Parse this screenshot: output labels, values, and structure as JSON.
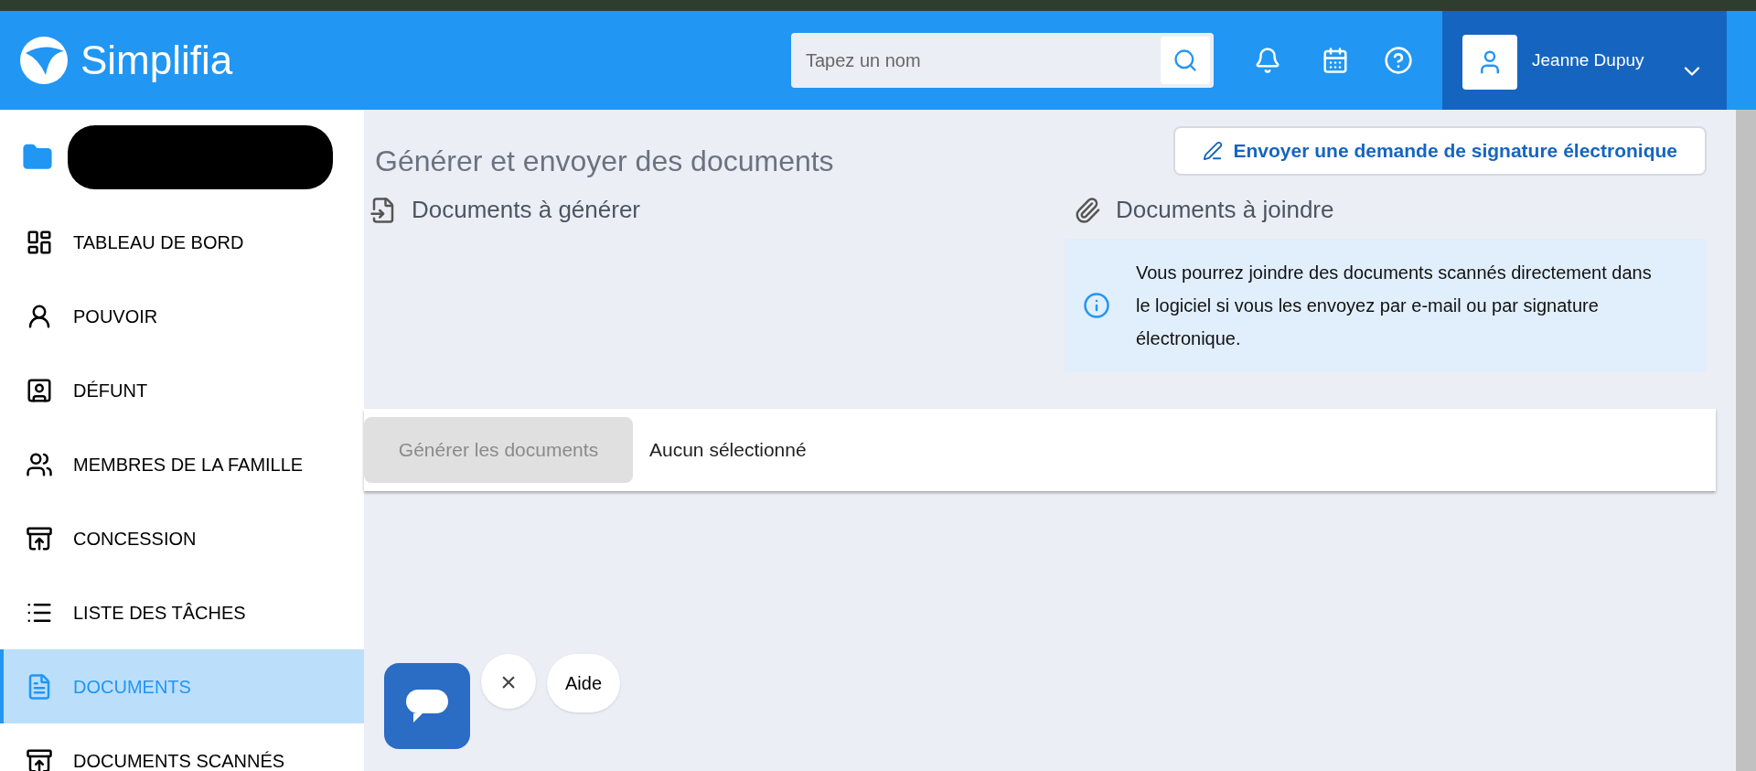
{
  "header": {
    "logo": "Simplifia",
    "search": {
      "placeholder": "Tapez un nom"
    },
    "user": {
      "name": "Jeanne Dupuy"
    }
  },
  "sidebar": {
    "items": [
      {
        "label": "TABLEAU DE BORD",
        "kind": "dashboard",
        "selected": false
      },
      {
        "label": "POUVOIR",
        "kind": "person",
        "selected": false
      },
      {
        "label": "DÉFUNT",
        "kind": "badge",
        "selected": false
      },
      {
        "label": "MEMBRES DE LA FAMILLE",
        "kind": "people",
        "selected": false
      },
      {
        "label": "CONCESSION",
        "kind": "grave",
        "selected": false
      },
      {
        "label": "LISTE DES TÂCHES",
        "kind": "list",
        "selected": false
      },
      {
        "label": "DOCUMENTS",
        "kind": "document",
        "selected": true
      },
      {
        "label": "DOCUMENTS SCANNÉS",
        "kind": "download",
        "selected": false
      }
    ]
  },
  "main": {
    "title": "Générer et envoyer des documents",
    "signature_button": "Envoyer une demande de signature électronique",
    "generate_section": {
      "title": "Documents à générer"
    },
    "attach_section": {
      "title": "Documents à joindre",
      "info": "Vous pourrez joindre des documents scannés directement dans le logiciel si vous les envoyez par e-mail ou par signature électronique."
    },
    "action_bar": {
      "button": {
        "label": "Générer les documents",
        "disabled": true
      },
      "status": "Aucun sélectionné"
    }
  },
  "help_widget": {
    "close": "×",
    "label": "Aide"
  }
}
